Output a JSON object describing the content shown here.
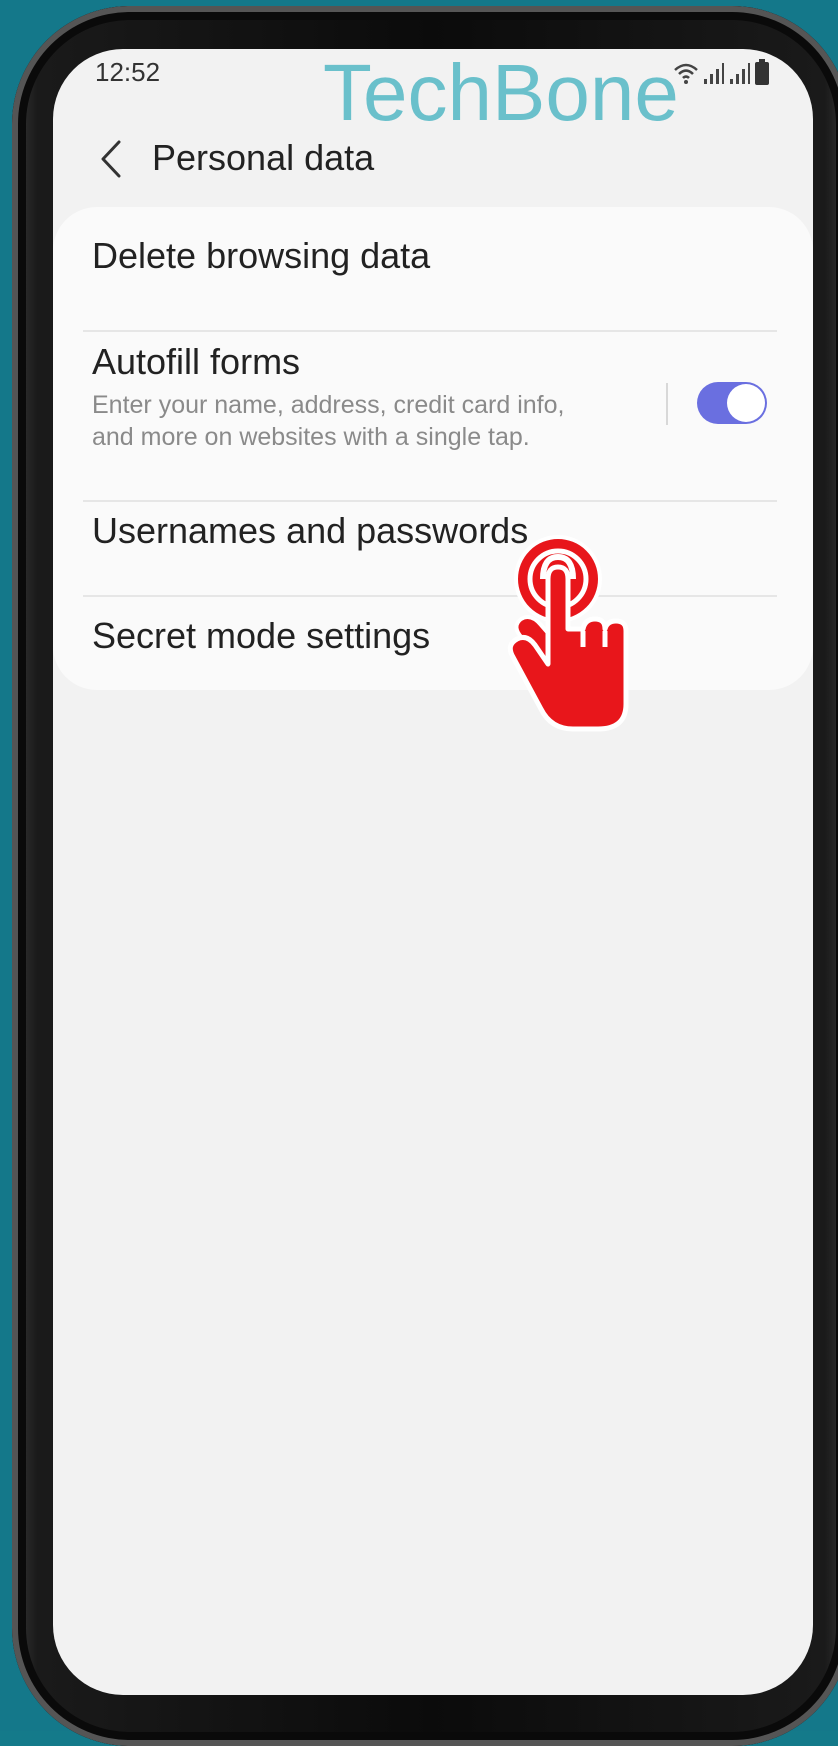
{
  "status_bar": {
    "time": "12:52",
    "icons": [
      "wifi-icon",
      "signal-icon",
      "signal-icon",
      "battery-icon"
    ]
  },
  "watermark": {
    "text": "TechBone",
    "color": "#5fbcc8"
  },
  "header": {
    "title": "Personal data",
    "back_icon": "chevron-left-icon"
  },
  "settings": {
    "items": [
      {
        "label": "Delete browsing data"
      },
      {
        "label": "Autofill forms",
        "description_line1": "Enter your name, address, credit card info,",
        "description_line2": "and more on websites with a single tap.",
        "toggle_on": true
      },
      {
        "label": "Usernames and passwords"
      },
      {
        "label": "Secret mode settings"
      }
    ]
  },
  "colors": {
    "accent_toggle": "#6a6fe0",
    "tap_indicator": "#e8161b",
    "background": "#14788a"
  }
}
